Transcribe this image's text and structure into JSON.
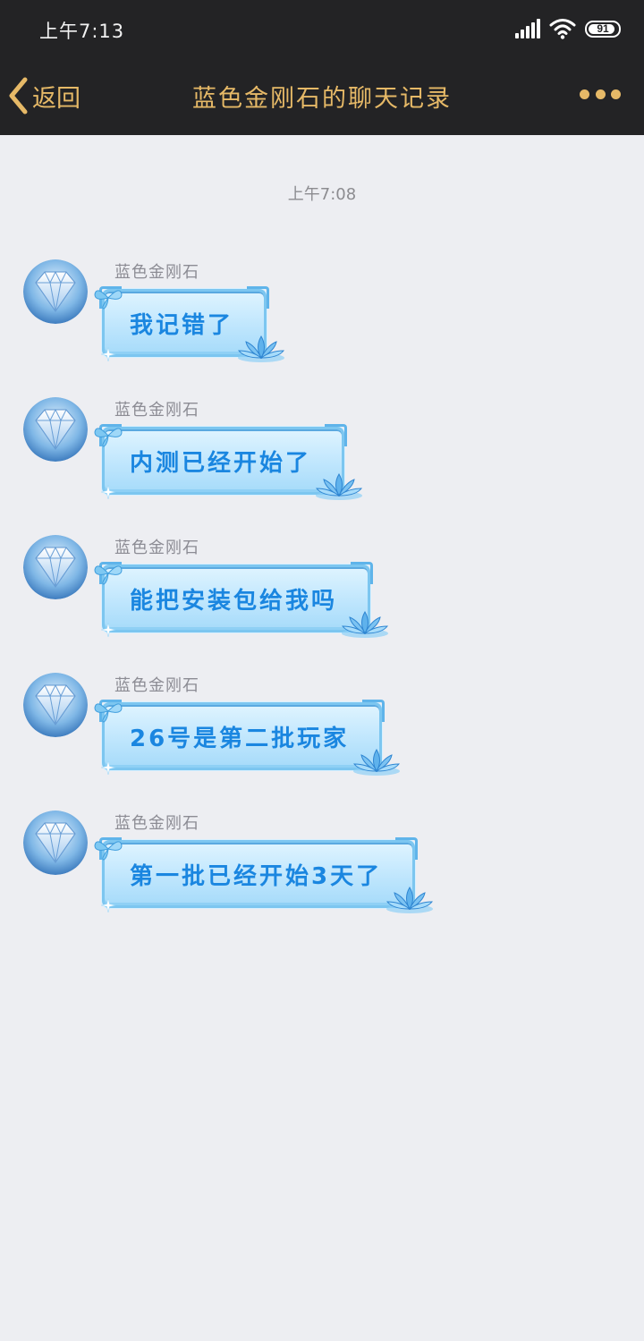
{
  "status_bar": {
    "time": "上午7:13",
    "battery": "91",
    "battery_level": 0.91,
    "signal_bars": 5,
    "wifi": true
  },
  "nav": {
    "back_label": "返回",
    "title": "蓝色金刚石的聊天记录",
    "more_icon": "more-dots-icon",
    "accent_color": "#e6b967",
    "bar_color": "#232325"
  },
  "chat": {
    "timestamp": "上午7:08",
    "messages": [
      {
        "sender": "蓝色金刚石",
        "text": "我记错了"
      },
      {
        "sender": "蓝色金刚石",
        "text": "内测已经开始了"
      },
      {
        "sender": "蓝色金刚石",
        "text": "能把安装包给我吗"
      },
      {
        "sender": "蓝色金刚石",
        "text": "26号是第二批玩家"
      },
      {
        "sender": "蓝色金刚石",
        "text": "第一批已经开始3天了"
      }
    ]
  }
}
